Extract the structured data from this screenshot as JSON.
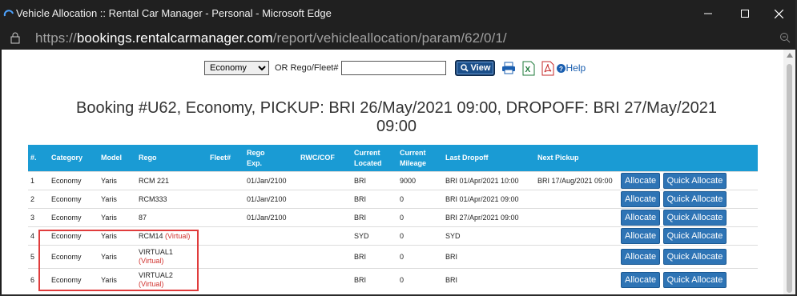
{
  "window": {
    "title": "Vehicle Allocation :: Rental Car Manager - Personal - Microsoft Edge",
    "url_prefix": "https://",
    "url_host": "bookings.rentalcarmanager.com",
    "url_path": "/report/vehicleallocation/param/62/0/1/"
  },
  "controls": {
    "category_selected": "Economy",
    "rego_label": "OR Rego/Fleet#",
    "rego_value": "",
    "view_label": "View",
    "help_label": "Help"
  },
  "heading_line1": "Booking #U62, Economy, PICKUP: BRI 26/May/2021 09:00, DROPOFF: BRI 27/May/2021",
  "heading_line2": "09:00",
  "table": {
    "headers": [
      "#.",
      "Category",
      "Model",
      "Rego",
      "Fleet#",
      "Rego\nExp.",
      "RWC/COF",
      "Current\nLocated",
      "Current\nMileage",
      "Last Dropoff",
      "Next Pickup",
      ""
    ],
    "rows": [
      {
        "num": "1",
        "category": "Economy",
        "model": "Yaris",
        "rego": "RCM 221",
        "virtual": "",
        "fleet": "",
        "rego_exp": "01/Jan/2100",
        "rwc": "",
        "located": "BRI",
        "mileage": "9000",
        "last_dropoff": "BRI  01/Apr/2021 10:00",
        "next_pickup": "BRI 17/Aug/2021 09:00"
      },
      {
        "num": "2",
        "category": "Economy",
        "model": "Yaris",
        "rego": "RCM333",
        "virtual": "",
        "fleet": "",
        "rego_exp": "01/Jan/2100",
        "rwc": "",
        "located": "BRI",
        "mileage": "0",
        "last_dropoff": "BRI  01/Apr/2021 09:00",
        "next_pickup": ""
      },
      {
        "num": "3",
        "category": "Economy",
        "model": "Yaris",
        "rego": "87",
        "virtual": "",
        "fleet": "",
        "rego_exp": "01/Jan/2100",
        "rwc": "",
        "located": "BRI",
        "mileage": "0",
        "last_dropoff": "BRI  27/Apr/2021 09:00",
        "next_pickup": ""
      },
      {
        "num": "4",
        "category": "Economy",
        "model": "Yaris",
        "rego": "RCM14",
        "virtual": "(Virtual)",
        "fleet": "",
        "rego_exp": "",
        "rwc": "",
        "located": "SYD",
        "mileage": "0",
        "last_dropoff": "SYD",
        "next_pickup": ""
      },
      {
        "num": "5",
        "category": "Economy",
        "model": "Yaris",
        "rego": "VIRTUAL1",
        "virtual": "(Virtual)",
        "fleet": "",
        "rego_exp": "",
        "rwc": "",
        "located": "BRI",
        "mileage": "0",
        "last_dropoff": "BRI",
        "next_pickup": ""
      },
      {
        "num": "6",
        "category": "Economy",
        "model": "Yaris",
        "rego": "VIRTUAL2",
        "virtual": "(Virtual)",
        "fleet": "",
        "rego_exp": "",
        "rwc": "",
        "located": "BRI",
        "mileage": "0",
        "last_dropoff": "BRI",
        "next_pickup": ""
      }
    ],
    "allocate_label": "Allocate",
    "quick_allocate_label": "Quick Allocate"
  }
}
